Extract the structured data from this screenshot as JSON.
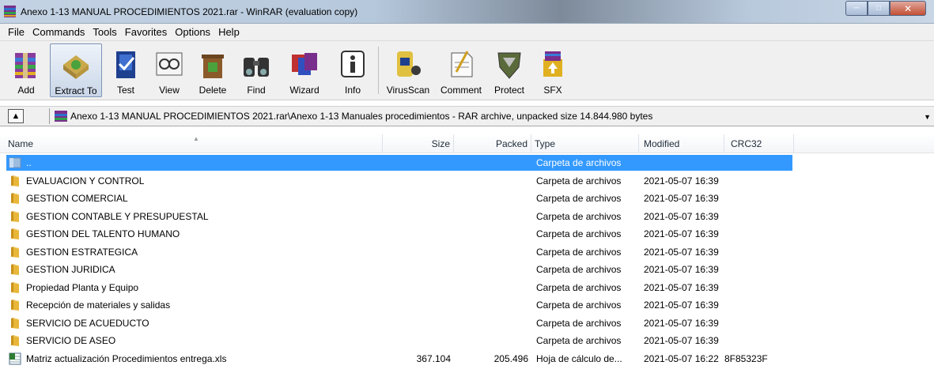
{
  "window": {
    "title": "Anexo 1-13  MANUAL PROCEDIMIENTOS 2021.rar - WinRAR (evaluation copy)"
  },
  "menu": [
    "File",
    "Commands",
    "Tools",
    "Favorites",
    "Options",
    "Help"
  ],
  "toolbar": {
    "add": "Add",
    "extract_to": "Extract To",
    "test": "Test",
    "view": "View",
    "delete": "Delete",
    "find": "Find",
    "wizard": "Wizard",
    "info": "Info",
    "virusscan": "VirusScan",
    "comment": "Comment",
    "protect": "Protect",
    "sfx": "SFX"
  },
  "path": {
    "text": "Anexo 1-13  MANUAL PROCEDIMIENTOS 2021.rar\\Anexo 1-13 Manuales procedimientos - RAR archive, unpacked size 14.844.980 bytes"
  },
  "columns": {
    "name": "Name",
    "size": "Size",
    "packed": "Packed",
    "type": "Type",
    "modified": "Modified",
    "crc": "CRC32"
  },
  "rows": [
    {
      "name": "..",
      "size": "",
      "packed": "",
      "type": "Carpeta de archivos",
      "modified": "",
      "crc": "",
      "icon": "folder-up-icon"
    },
    {
      "name": "EVALUACION Y CONTROL",
      "size": "",
      "packed": "",
      "type": "Carpeta de archivos",
      "modified": "2021-05-07 16:39",
      "crc": "",
      "icon": "folder-icon"
    },
    {
      "name": "GESTION COMERCIAL",
      "size": "",
      "packed": "",
      "type": "Carpeta de archivos",
      "modified": "2021-05-07 16:39",
      "crc": "",
      "icon": "folder-icon"
    },
    {
      "name": "GESTION CONTABLE Y PRESUPUESTAL",
      "size": "",
      "packed": "",
      "type": "Carpeta de archivos",
      "modified": "2021-05-07 16:39",
      "crc": "",
      "icon": "folder-icon"
    },
    {
      "name": "GESTION DEL TALENTO HUMANO",
      "size": "",
      "packed": "",
      "type": "Carpeta de archivos",
      "modified": "2021-05-07 16:39",
      "crc": "",
      "icon": "folder-icon"
    },
    {
      "name": "GESTION ESTRATEGICA",
      "size": "",
      "packed": "",
      "type": "Carpeta de archivos",
      "modified": "2021-05-07 16:39",
      "crc": "",
      "icon": "folder-icon"
    },
    {
      "name": "GESTION JURIDICA",
      "size": "",
      "packed": "",
      "type": "Carpeta de archivos",
      "modified": "2021-05-07 16:39",
      "crc": "",
      "icon": "folder-icon"
    },
    {
      "name": "Propiedad Planta y Equipo",
      "size": "",
      "packed": "",
      "type": "Carpeta de archivos",
      "modified": "2021-05-07 16:39",
      "crc": "",
      "icon": "folder-icon"
    },
    {
      "name": "Recepción de materiales y salidas",
      "size": "",
      "packed": "",
      "type": "Carpeta de archivos",
      "modified": "2021-05-07 16:39",
      "crc": "",
      "icon": "folder-icon"
    },
    {
      "name": "SERVICIO DE ACUEDUCTO",
      "size": "",
      "packed": "",
      "type": "Carpeta de archivos",
      "modified": "2021-05-07 16:39",
      "crc": "",
      "icon": "folder-icon"
    },
    {
      "name": "SERVICIO DE ASEO",
      "size": "",
      "packed": "",
      "type": "Carpeta de archivos",
      "modified": "2021-05-07 16:39",
      "crc": "",
      "icon": "folder-icon"
    },
    {
      "name": "Matriz actualización Procedimientos entrega.xls",
      "size": "367.104",
      "packed": "205.496",
      "type": "Hoja de cálculo de...",
      "modified": "2021-05-07 16:22",
      "crc": "8F85323F",
      "icon": "excel-file-icon"
    }
  ]
}
